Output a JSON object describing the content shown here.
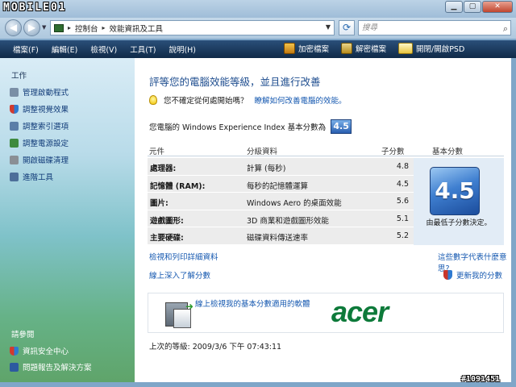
{
  "watermark": "MOBILE01",
  "window_controls": {
    "minimize": "▁",
    "maximize": "▢",
    "close": "✕"
  },
  "address": {
    "segments": [
      "控制台",
      "效能資訊及工具"
    ],
    "search_placeholder": "搜尋"
  },
  "menu": {
    "items": [
      "檔案(F)",
      "編輯(E)",
      "檢視(V)",
      "工具(T)",
      "說明(H)"
    ],
    "commands": [
      "加密檔案",
      "解密檔案",
      "開閉/開啟PSD"
    ]
  },
  "sidebar": {
    "tasks_header": "工作",
    "tasks": [
      "管理啟動程式",
      "調整視覺效果",
      "調整索引選項",
      "調整電源設定",
      "開啟磁碟清理",
      "進階工具"
    ],
    "see_also_header": "請參閱",
    "see_also": [
      "資訊安全中心",
      "問題報告及解決方案"
    ]
  },
  "main": {
    "title": "評等您的電腦效能等級，並且進行改善",
    "tip_text": "您不確定從何處開始嗎？",
    "tip_link": "瞭解如何改善電腦的效能。",
    "score_label": "您電腦的 Windows Experience Index 基本分數為",
    "base_score": "4.5",
    "table": {
      "headers": [
        "元件",
        "分級資料",
        "子分數",
        "基本分數"
      ],
      "rows": [
        {
          "component": "處理器:",
          "detail": "計算 (每秒)",
          "score": "4.8"
        },
        {
          "component": "記憶體 (RAM):",
          "detail": "每秒的記憶體運算",
          "score": "4.5"
        },
        {
          "component": "圖片:",
          "detail": "Windows Aero 的桌面效能",
          "score": "5.6"
        },
        {
          "component": "遊戲圖形:",
          "detail": "3D 商業和遊戲圖形效能",
          "score": "5.1"
        },
        {
          "component": "主要硬碟:",
          "detail": "磁碟資料傳送速率",
          "score": "5.2"
        }
      ],
      "base_caption": "由最低子分數決定。"
    },
    "link_print": "檢視和列印詳細資料",
    "link_meaning": "這些數字代表什麼意思?",
    "link_learn": "線上深入了解分數",
    "link_update": "更新我的分數",
    "ad_text": "線上檢視我的基本分數適用的軟體",
    "ad_brand": "acer",
    "last_grade": "上次的等級: 2009/3/6 下午 07:43:11"
  },
  "bottom_id": "#1091451"
}
